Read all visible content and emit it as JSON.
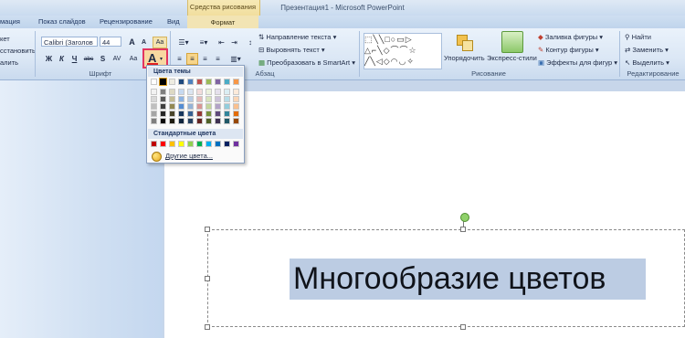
{
  "window": {
    "title": "Презентация1 - Microsoft PowerPoint"
  },
  "context_tab_group": {
    "title": "Средства рисования",
    "tab": "Формат"
  },
  "tabs": [
    "мация",
    "Показ слайдов",
    "Рецензирование",
    "Вид"
  ],
  "ribbon": {
    "clipboard": {
      "cut": "кет",
      "restore": "сстановить",
      "delete": "алить"
    },
    "font": {
      "group_label": "Шрифт",
      "font_name": "Calibri (Заголов",
      "font_size": "44",
      "grow": "A",
      "shrink": "A",
      "clear": "Aa",
      "bold": "Ж",
      "italic": "К",
      "underline": "Ч",
      "strike": "abc",
      "shadow": "S",
      "spacing": "AV",
      "case": "Aa",
      "font_color": "A"
    },
    "paragraph": {
      "group_label": "Абзац",
      "text_direction": "Направление текста",
      "align_text": "Выровнять текст",
      "smartart": "Преобразовать в SmartArt"
    },
    "drawing": {
      "group_label": "Рисование",
      "arrange": "Упорядочить",
      "quick_styles": "Экспресс-стили",
      "shape_fill": "Заливка фигуры",
      "shape_outline": "Контур фигуры",
      "shape_effects": "Эффекты для фигур"
    },
    "editing": {
      "group_label": "Редактирование",
      "find": "Найти",
      "replace": "Заменить",
      "select": "Выделить"
    }
  },
  "font_color_dropdown": {
    "theme_header": "Цвета темы",
    "theme_top_row": [
      "#ffffff",
      "#000000",
      "#eeece1",
      "#1f497d",
      "#4f81bd",
      "#c0504d",
      "#9bbb59",
      "#8064a2",
      "#4bacc6",
      "#f79646"
    ],
    "theme_shades": [
      [
        "#f2f2f2",
        "#7f7f7f",
        "#ddd9c3",
        "#c6d9f0",
        "#dbe5f1",
        "#f2dcdb",
        "#ebf1dd",
        "#e5e0ec",
        "#dbeef3",
        "#fdeada"
      ],
      [
        "#d8d8d8",
        "#595959",
        "#c4bd97",
        "#8db3e2",
        "#b8cce4",
        "#e5b9b7",
        "#d7e3bc",
        "#ccc1d9",
        "#b7dde8",
        "#fbd5b5"
      ],
      [
        "#bfbfbf",
        "#3f3f3f",
        "#938953",
        "#548dd4",
        "#95b3d7",
        "#d99694",
        "#c3d69b",
        "#b2a2c7",
        "#92cddc",
        "#fac08f"
      ],
      [
        "#a5a5a5",
        "#262626",
        "#494429",
        "#17365d",
        "#366092",
        "#953734",
        "#76923c",
        "#5f497a",
        "#31859b",
        "#e36c09"
      ],
      [
        "#7f7f7f",
        "#0c0c0c",
        "#1d1b10",
        "#0f243e",
        "#244061",
        "#632423",
        "#4f6128",
        "#3f3151",
        "#205867",
        "#974806"
      ]
    ],
    "standard_header": "Стандартные цвета",
    "standard_colors": [
      "#c00000",
      "#ff0000",
      "#ffc000",
      "#ffff00",
      "#92d050",
      "#00b050",
      "#00b0f0",
      "#0070c0",
      "#002060",
      "#7030a0"
    ],
    "more_colors": "Другие цвета..."
  },
  "slide": {
    "text": "Многообразие цветов"
  }
}
